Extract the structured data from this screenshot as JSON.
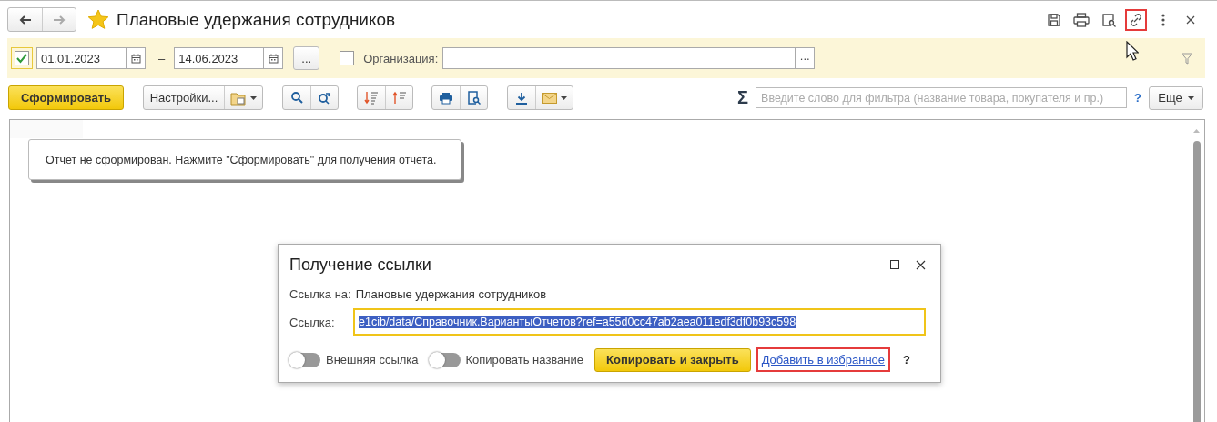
{
  "window": {
    "title": "Плановые удержания сотрудников",
    "favorite": true,
    "header_icons": [
      {
        "kind": "save",
        "highlighted": false
      },
      {
        "kind": "print",
        "highlighted": false
      },
      {
        "kind": "preview",
        "highlighted": false
      },
      {
        "kind": "link",
        "highlighted": true
      },
      {
        "kind": "more",
        "highlighted": false
      },
      {
        "kind": "close",
        "highlighted": false
      }
    ]
  },
  "filter": {
    "period_checked": true,
    "date_from": "01.01.2023",
    "separator": "–",
    "date_to": "14.06.2023",
    "period_button": "...",
    "organization": {
      "checked": false,
      "label": "Организация:",
      "select_button": "..."
    }
  },
  "toolbar": {
    "generate_button": "Сформировать",
    "settings_button": "Настройки...",
    "sum": "Σ",
    "search_placeholder": "Введите слово для фильтра (название товара, покупателя и пр.)",
    "help": "?",
    "more_button": "Еще"
  },
  "report": {
    "message": "Отчет не сформирован. Нажмите \"Сформировать\" для получения отчета."
  },
  "dialog": {
    "title": "Получение ссылки",
    "target_label": "Ссылка на:",
    "target": "Плановые удержания сотрудников",
    "link_label": "Ссылка:",
    "link": "e1cib/data/Справочник.ВариантыОтчетов?ref=a55d0cc47ab2aea011edf3df0b93c598",
    "switches": [
      {
        "label": "Внешняя ссылка",
        "on": false
      },
      {
        "label": "Копировать название",
        "on": false
      }
    ],
    "copy_button": "Копировать и закрыть",
    "favorite_link": {
      "text": "Добавить в избранное",
      "highlighted": true
    },
    "help": "?"
  }
}
